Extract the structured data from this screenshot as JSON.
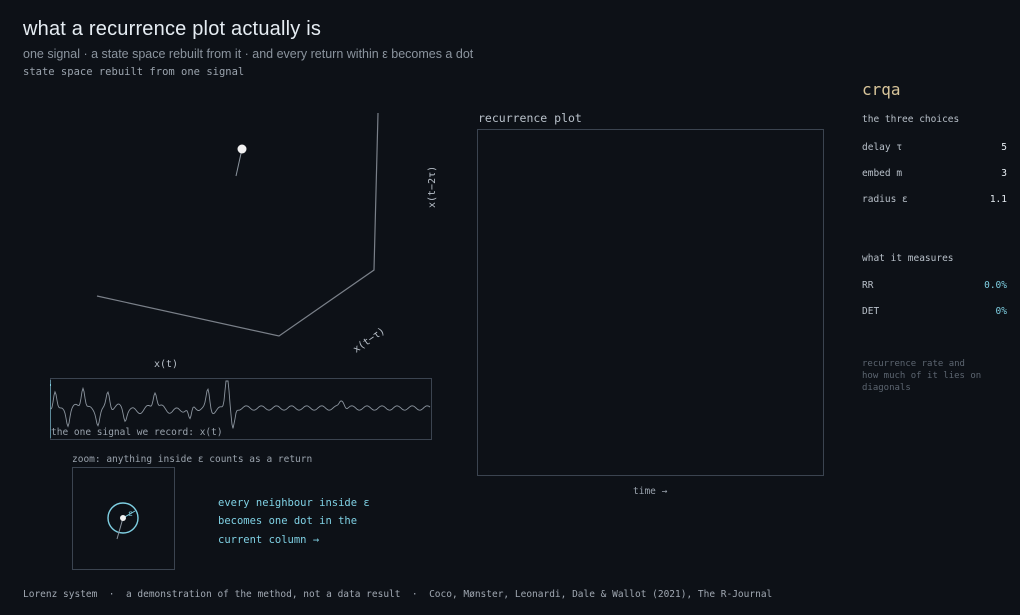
{
  "header": {
    "title": "what a recurrence plot actually is",
    "subtitle": "one signal · a state space rebuilt from it · and every return within ε becomes a dot",
    "state_caption": "state space rebuilt from one signal"
  },
  "state_space": {
    "axis_x": "x(t)",
    "axis_tau": "x(t−τ)",
    "axis_2tau": "x(t−2τ)"
  },
  "signal": {
    "caption": "the one signal we record:  x(t)"
  },
  "zoom": {
    "caption": "zoom: anything inside ε counts as a return",
    "epsilon": "ε",
    "lines": [
      "every neighbour inside ε",
      "becomes one dot in the",
      "current column   →"
    ]
  },
  "recurrence_plot": {
    "title": "recurrence plot",
    "time_label": "time  →"
  },
  "panel": {
    "title": "crqa",
    "choices_title": "the three choices",
    "params": [
      {
        "label": "delay  τ",
        "value": "5"
      },
      {
        "label": "embed  m",
        "value": "3"
      },
      {
        "label": "radius ε",
        "value": "1.1"
      }
    ],
    "measures_title": "what it measures",
    "metrics": [
      {
        "label": "RR",
        "value": "0.0%"
      },
      {
        "label": "DET",
        "value": "0%"
      }
    ],
    "note": "recurrence rate and how much of it lies on diagonals"
  },
  "footer": "Lorenz system  ·  a demonstration of the method, not a data result  ·  Coco, Mønster, Leonardi, Dale & Wallot (2021), The R-Journal",
  "colors": {
    "background": "#0d1117",
    "accent": "#7fd0e3",
    "panel_title": "#d8c59a"
  }
}
